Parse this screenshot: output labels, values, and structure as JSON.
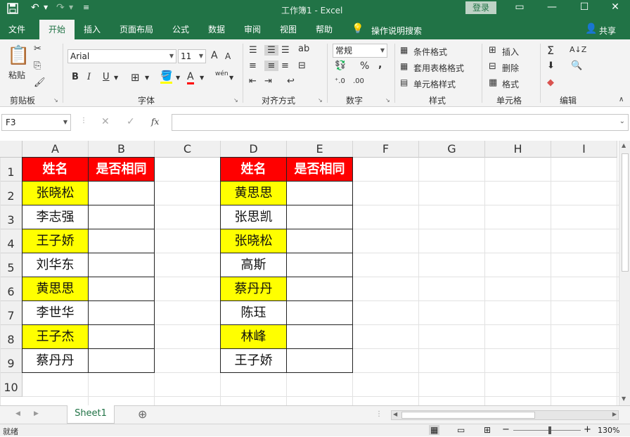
{
  "title_bar": {
    "doc_title": "工作簿1  -  Excel",
    "login": "登录"
  },
  "tabs": [
    {
      "label": "文件"
    },
    {
      "label": "开始"
    },
    {
      "label": "插入"
    },
    {
      "label": "页面布局"
    },
    {
      "label": "公式"
    },
    {
      "label": "数据"
    },
    {
      "label": "审阅"
    },
    {
      "label": "视图"
    },
    {
      "label": "帮助"
    }
  ],
  "tell_me": "操作说明搜索",
  "share": "共享",
  "ribbon": {
    "clipboard": {
      "paste": "粘贴",
      "group": "剪贴板"
    },
    "font": {
      "name": "Arial",
      "size": "11",
      "group": "字体",
      "bold": "B",
      "italic": "I",
      "underline": "U",
      "grow": "A",
      "shrink": "A",
      "wen": "wén"
    },
    "alignment": {
      "group": "对齐方式"
    },
    "number": {
      "format": "常规",
      "percent": "%",
      "comma": ",",
      "group": "数字"
    },
    "styles": {
      "cond": "条件格式",
      "table": "套用表格格式",
      "cell": "单元格样式",
      "group": "样式"
    },
    "cells": {
      "insert": "插入",
      "delete": "删除",
      "format": "格式",
      "group": "单元格"
    },
    "editing": {
      "group": "编辑"
    }
  },
  "formula_bar": {
    "name_box": "F3",
    "fx": "fx",
    "value": ""
  },
  "columns": [
    "A",
    "B",
    "C",
    "D",
    "E",
    "F",
    "G",
    "H",
    "I"
  ],
  "rows": [
    "1",
    "2",
    "3",
    "4",
    "5",
    "6",
    "7",
    "8",
    "9",
    "10"
  ],
  "table1": {
    "header": [
      "姓名",
      "是否相同"
    ],
    "names": [
      "张晓松",
      "李志强",
      "王子娇",
      "刘华东",
      "黄思思",
      "李世华",
      "王子杰",
      "蔡丹丹"
    ]
  },
  "table2": {
    "header": [
      "姓名",
      "是否相同"
    ],
    "names": [
      "黄思思",
      "张思凯",
      "张晓松",
      "高斯",
      "蔡丹丹",
      "陈珏",
      "林峰",
      "王子娇"
    ]
  },
  "colors": {
    "header_bg": "#ff0000",
    "highlight": "#ffff00",
    "excel_green": "#217346"
  },
  "sheet_tabs": [
    "Sheet1"
  ],
  "status": {
    "ready": "就绪",
    "zoom": "130%"
  }
}
